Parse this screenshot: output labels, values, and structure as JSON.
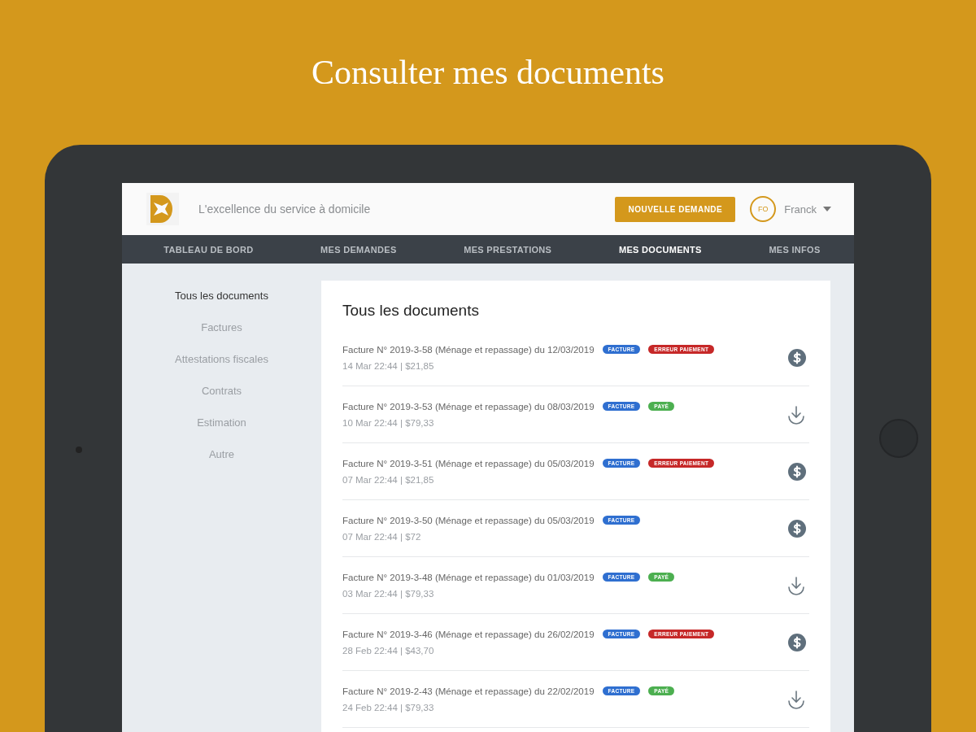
{
  "headline": "Consulter mes documents",
  "header": {
    "tagline": "L'excellence du service à domicile",
    "button": "NOUVELLE DEMANDE",
    "user": {
      "initials": "FO",
      "name": "Franck"
    }
  },
  "nav": [
    {
      "label": "TABLEAU DE BORD",
      "selected": false
    },
    {
      "label": "MES DEMANDES",
      "selected": false
    },
    {
      "label": "MES PRESTATIONS",
      "selected": false
    },
    {
      "label": "MES DOCUMENTS",
      "selected": true
    },
    {
      "label": "MES INFOS",
      "selected": false
    }
  ],
  "sidebar": [
    {
      "label": "Tous les documents",
      "selected": true
    },
    {
      "label": "Factures",
      "selected": false
    },
    {
      "label": "Attestations fiscales",
      "selected": false
    },
    {
      "label": "Contrats",
      "selected": false
    },
    {
      "label": "Estimation",
      "selected": false
    },
    {
      "label": "Autre",
      "selected": false
    }
  ],
  "panel_title": "Tous les documents",
  "documents": [
    {
      "title": "Facture N° 2019-3-58 (Ménage et repassage) du 12/03/2019",
      "meta": "14 Mar 22:44 | $21,85",
      "kind": "pay",
      "tags": [
        {
          "label": "FACTURE",
          "color": "#2f6fd0"
        },
        {
          "label": "ERREUR PAIEMENT",
          "color": "#c62828"
        }
      ]
    },
    {
      "title": "Facture N° 2019-3-53 (Ménage et repassage) du 08/03/2019",
      "meta": "10 Mar 22:44 | $79,33",
      "kind": "download",
      "tags": [
        {
          "label": "FACTURE",
          "color": "#2f6fd0"
        },
        {
          "label": "PAYÉ",
          "color": "#4caf50"
        }
      ]
    },
    {
      "title": "Facture N° 2019-3-51 (Ménage et repassage) du 05/03/2019",
      "meta": "07 Mar 22:44 | $21,85",
      "kind": "pay",
      "tags": [
        {
          "label": "FACTURE",
          "color": "#2f6fd0"
        },
        {
          "label": "ERREUR PAIEMENT",
          "color": "#c62828"
        }
      ]
    },
    {
      "title": "Facture N° 2019-3-50 (Ménage et repassage) du 05/03/2019",
      "meta": "07 Mar 22:44 | $72",
      "kind": "pay",
      "tags": [
        {
          "label": "FACTURE",
          "color": "#2f6fd0"
        }
      ]
    },
    {
      "title": "Facture N° 2019-3-48 (Ménage et repassage) du 01/03/2019",
      "meta": "03 Mar 22:44 | $79,33",
      "kind": "download",
      "tags": [
        {
          "label": "FACTURE",
          "color": "#2f6fd0"
        },
        {
          "label": "PAYÉ",
          "color": "#4caf50"
        }
      ]
    },
    {
      "title": "Facture N° 2019-3-46 (Ménage et repassage) du 26/02/2019",
      "meta": "28 Feb 22:44 | $43,70",
      "kind": "pay",
      "tags": [
        {
          "label": "FACTURE",
          "color": "#2f6fd0"
        },
        {
          "label": "ERREUR PAIEMENT",
          "color": "#c62828"
        }
      ]
    },
    {
      "title": "Facture N° 2019-2-43 (Ménage et repassage) du 22/02/2019",
      "meta": "24 Feb 22:44 | $79,33",
      "kind": "download",
      "tags": [
        {
          "label": "FACTURE",
          "color": "#2f6fd0"
        },
        {
          "label": "PAYÉ",
          "color": "#4caf50"
        }
      ]
    }
  ]
}
